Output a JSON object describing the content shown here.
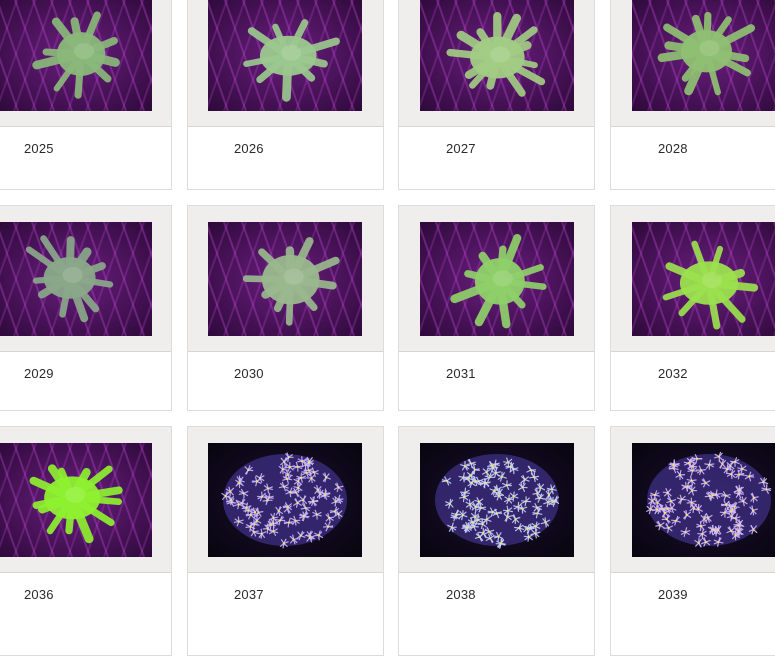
{
  "gallery": {
    "items": [
      {
        "label": "2025",
        "subject": "coral-green-star-icon",
        "color": "#8ab87a"
      },
      {
        "label": "2026",
        "subject": "coral-green-star-icon",
        "color": "#9bc88e"
      },
      {
        "label": "2027",
        "subject": "coral-green-star-icon",
        "color": "#a2cc84"
      },
      {
        "label": "2028",
        "subject": "coral-green-star-icon",
        "color": "#8fc072"
      },
      {
        "label": "2029",
        "subject": "coral-green-star-icon",
        "color": "#8aa88a"
      },
      {
        "label": "2030",
        "subject": "coral-green-star-icon",
        "color": "#9ab88e"
      },
      {
        "label": "2031",
        "subject": "coral-green-star-icon",
        "color": "#8fd06a"
      },
      {
        "label": "2032",
        "subject": "coral-green-star-icon",
        "color": "#9be04e"
      },
      {
        "label": "2036",
        "subject": "coral-green-star-icon",
        "color": "#8ef030"
      },
      {
        "label": "2037",
        "subject": "coral-polyp-colony-icon",
        "color": "#c9b6ff"
      },
      {
        "label": "2038",
        "subject": "coral-polyp-colony-icon",
        "color": "#c6d0ff"
      },
      {
        "label": "2039",
        "subject": "coral-polyp-colony-icon",
        "color": "#d2b8ff"
      }
    ]
  }
}
